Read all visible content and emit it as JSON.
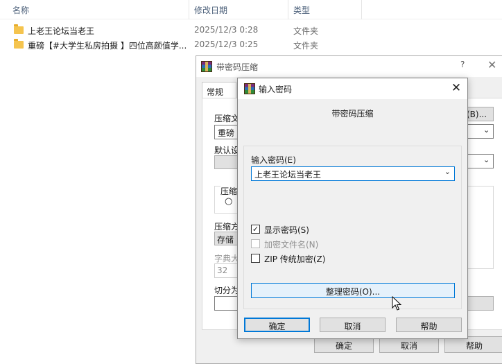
{
  "explorer": {
    "columns": {
      "name": "名称",
      "date": "修改日期",
      "type": "类型"
    },
    "rows": [
      {
        "name": "上老王论坛当老王",
        "date": "2025/12/3 0:28",
        "type": "文件夹"
      },
      {
        "name": "重磅【#大学生私房拍摄 】四位高颜值学...",
        "date": "2025/12/3 0:25",
        "type": "文件夹"
      }
    ]
  },
  "back_dialog": {
    "title": "带密码压缩",
    "help_glyph": "?",
    "close_glyph": "✕",
    "tab_general": "常规",
    "labels": {
      "archive_name": "压缩文",
      "archive_value": "重磅",
      "default_settings": "默认设",
      "archive_format": "压缩",
      "compression_method": "压缩方",
      "method_value": "存储",
      "dictionary_size": "字典大",
      "dictionary_value": "32",
      "split_volumes": "切分为"
    },
    "browse_label": "(B)...",
    "buttons": {
      "ok": "确定",
      "cancel": "取消",
      "help": "帮助"
    }
  },
  "password_dialog": {
    "title": "输入密码",
    "close_glyph": "✕",
    "heading": "带密码压缩",
    "password_label": "输入密码(E)",
    "password_value": "上老王论坛当老王",
    "checkboxes": {
      "show_password": {
        "label": "显示密码(S)",
        "checked": true,
        "mark": "✓"
      },
      "encrypt_file_names": {
        "label": "加密文件名(N)",
        "checked": false
      },
      "zip_legacy_encryption": {
        "label": "ZIP 传统加密(Z)",
        "checked": false
      }
    },
    "organize_button": "整理密码(O)...",
    "buttons": {
      "ok": "确定",
      "cancel": "取消",
      "help": "帮助"
    }
  },
  "icons": {
    "folder": "folder-icon",
    "app": "winrar-icon",
    "chevron": "chevron-down-icon",
    "close": "close-icon",
    "cursor": "mouse-cursor-icon"
  },
  "colors": {
    "accent": "#0078d7",
    "folder": "#f5c44e",
    "dialog_bg": "#f0f0f0",
    "button_bg": "#e1e1e1"
  }
}
